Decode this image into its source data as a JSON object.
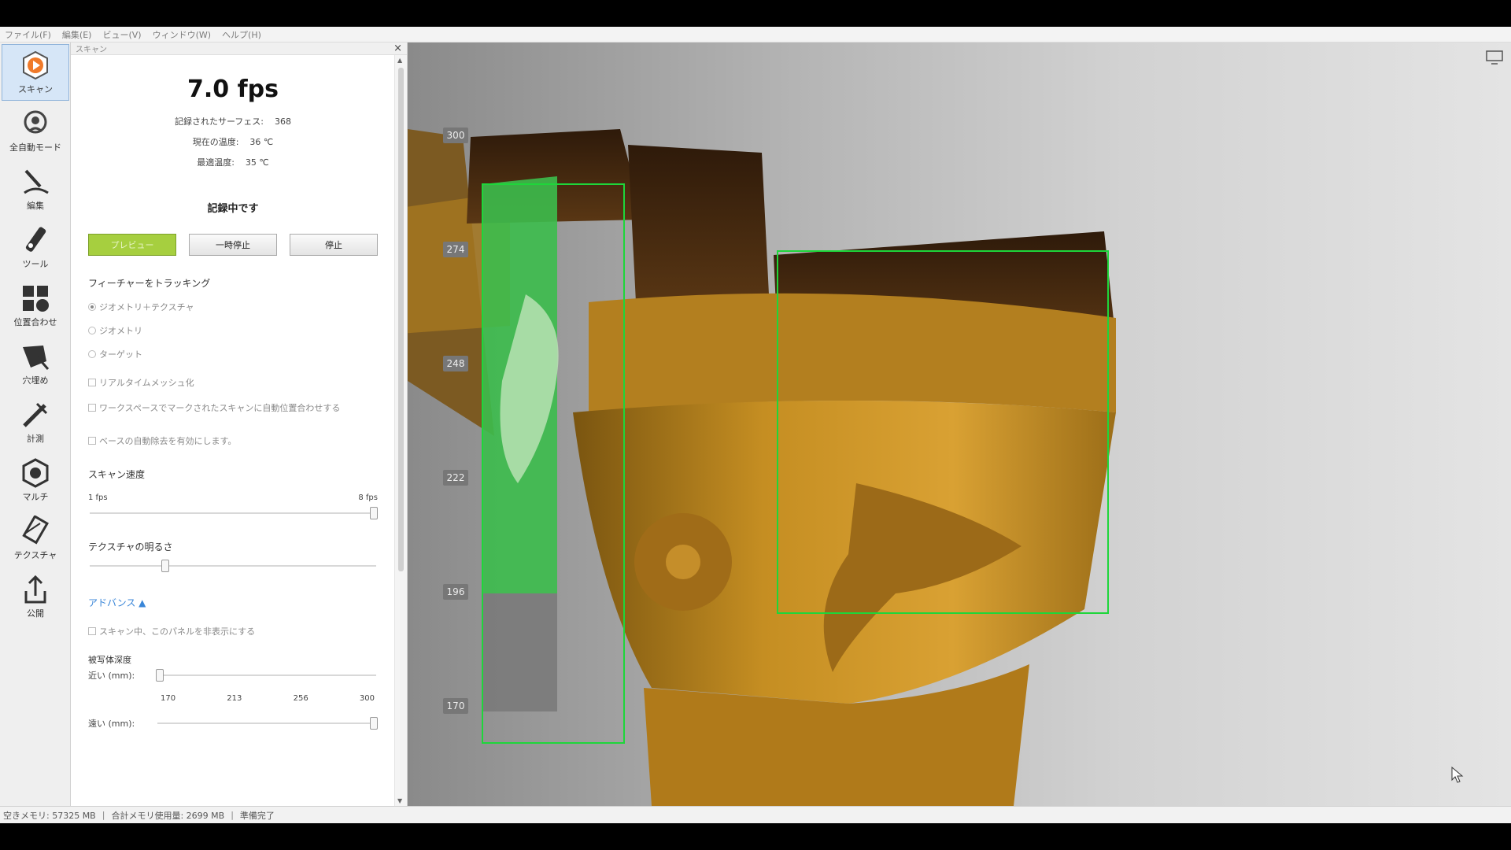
{
  "menu": [
    "ファイル(F)",
    "編集(E)",
    "ビュー(V)",
    "ウィンドウ(W)",
    "ヘルプ(H)"
  ],
  "toolbar": [
    {
      "label": "スキャン",
      "icon": "scan-icon",
      "active": true
    },
    {
      "label": "全自動モード",
      "icon": "auto-mode-icon"
    },
    {
      "label": "編集",
      "icon": "edit-icon"
    },
    {
      "label": "ツール",
      "icon": "tools-icon"
    },
    {
      "label": "位置合わせ",
      "icon": "align-icon"
    },
    {
      "label": "穴埋め",
      "icon": "fill-holes-icon"
    },
    {
      "label": "計測",
      "icon": "measure-icon"
    },
    {
      "label": "マルチ",
      "icon": "multi-icon"
    },
    {
      "label": "テクスチャ",
      "icon": "texture-icon"
    },
    {
      "label": "公開",
      "icon": "publish-icon"
    }
  ],
  "panel": {
    "title": "スキャン",
    "fps": "7.0 fps",
    "stats": [
      {
        "label": "記録されたサーフェス:",
        "value": "368"
      },
      {
        "label": "現在の温度:",
        "value": "36 ℃"
      },
      {
        "label": "最適温度:",
        "value": "35 ℃"
      }
    ],
    "status": "記録中です",
    "buttons": {
      "preview": "プレビュー",
      "pause": "一時停止",
      "stop": "停止"
    },
    "tracking": {
      "label": "フィーチャーをトラッキング",
      "options": [
        "ジオメトリ＋テクスチャ",
        "ジオメトリ",
        "ターゲット"
      ],
      "selected": 0
    },
    "checks": [
      "リアルタイムメッシュ化",
      "ワークスペースでマークされたスキャンに自動位置合わせする",
      "ベースの自動除去を有効にします。"
    ],
    "scan_speed": {
      "label": "スキャン速度",
      "min_label": "1 fps",
      "max_label": "8 fps",
      "fraction": 1.0
    },
    "texture_brightness": {
      "label": "テクスチャの明るさ",
      "fraction": 0.26
    },
    "advanced": "アドバンス ▲",
    "hide_panel": "スキャン中、このパネルを非表示にする",
    "depth": {
      "label": "被写体深度",
      "near_label": "近い (mm):",
      "far_label": "遠い (mm):",
      "ticks": [
        "170",
        "213",
        "256",
        "300"
      ],
      "near_fraction": 0.0,
      "far_fraction": 1.0
    }
  },
  "viewport": {
    "depth_labels": [
      "300",
      "274",
      "248",
      "222",
      "196",
      "170"
    ]
  },
  "statusbar": {
    "free_memory": "空きメモリ: 57325 MB",
    "used_memory": "合計メモリ使用量: 2699 MB",
    "state": "準備完了"
  }
}
